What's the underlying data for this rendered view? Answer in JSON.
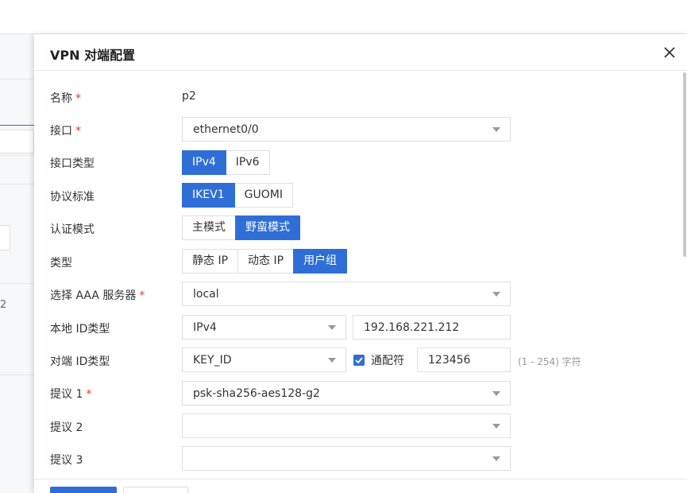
{
  "dialog": {
    "title": "VPN 对端配置"
  },
  "background": {
    "partial_cell_text": "2"
  },
  "form": {
    "name": {
      "label": "名称",
      "required": "*",
      "value": "p2"
    },
    "interface": {
      "label": "接口",
      "required": "*",
      "value": "ethernet0/0"
    },
    "interface_type": {
      "label": "接口类型",
      "options": [
        "IPv4",
        "IPv6"
      ],
      "selected": "IPv4"
    },
    "protocol": {
      "label": "协议标准",
      "options": [
        "IKEV1",
        "GUOMI"
      ],
      "selected": "IKEV1"
    },
    "auth_mode": {
      "label": "认证模式",
      "options": [
        "主模式",
        "野蛮模式"
      ],
      "selected": "野蛮模式"
    },
    "type": {
      "label": "类型",
      "options": [
        "静态 IP",
        "动态 IP",
        "用户组"
      ],
      "selected": "用户组"
    },
    "aaa_server": {
      "label": "选择 AAA 服务器",
      "required": "*",
      "value": "local"
    },
    "local_id": {
      "label": "本地 ID类型",
      "type_value": "IPv4",
      "id_value": "192.168.221.212"
    },
    "peer_id": {
      "label": "对端 ID类型",
      "type_value": "KEY_ID",
      "wildcard_label": "通配符",
      "wildcard_checked": true,
      "id_value": "123456",
      "hint": "(1 - 254) 字符"
    },
    "proposal1": {
      "label": "提议 1",
      "required": "*",
      "value": "psk-sha256-aes128-g2"
    },
    "proposal2": {
      "label": "提议 2",
      "value": ""
    },
    "proposal3": {
      "label": "提议 3",
      "value": ""
    }
  },
  "colors": {
    "primary": "#2f6ed6",
    "required": "#e23636",
    "border": "#dcdfe6"
  }
}
